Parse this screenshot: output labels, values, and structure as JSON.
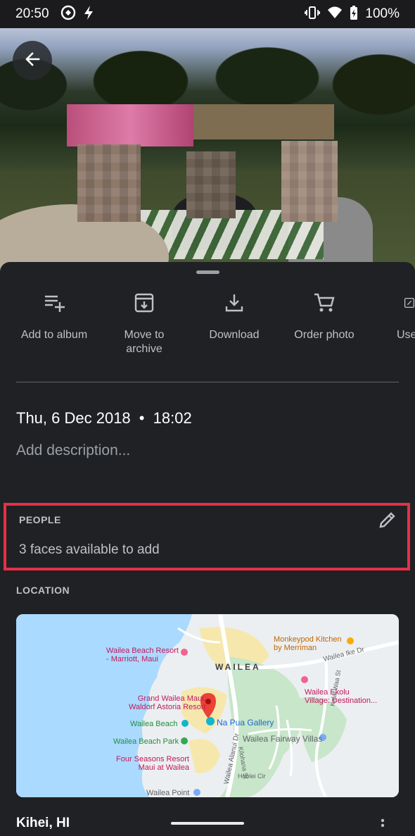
{
  "status_bar": {
    "time": "20:50",
    "battery_percent": "100%",
    "icons": [
      "app-badge-icon",
      "bolt-icon",
      "vibrate-icon",
      "wifi-icon",
      "battery-charging-icon"
    ]
  },
  "header": {
    "back_icon": "arrow-back-icon"
  },
  "photo": {
    "description_hidden": true
  },
  "actions": [
    {
      "label": "Add to album",
      "icon": "playlist-add-icon"
    },
    {
      "label": "Move to archive",
      "icon": "archive-icon"
    },
    {
      "label": "Download",
      "icon": "download-icon"
    },
    {
      "label": "Order photo",
      "icon": "cart-icon"
    },
    {
      "label": "Use",
      "icon": "open-external-icon"
    }
  ],
  "details": {
    "date": "Thu, 6 Dec 2018",
    "separator": "•",
    "time": "18:02",
    "description_placeholder": "Add description..."
  },
  "people": {
    "title": "PEOPLE",
    "summary": "3 faces available to add",
    "edit_icon": "pencil-icon",
    "highlight_color": "#e53048"
  },
  "location": {
    "title": "LOCATION",
    "place_name": "Kihei, HI",
    "map": {
      "labels": {
        "area": "WAILEA",
        "beach_resort": "Wailea Beach Resort\n- Marriott, Maui",
        "grand_wailea": "Grand Wailea Maui,\nWaldorf Astoria Resort",
        "wailea_beach": "Wailea Beach",
        "beach_park": "Wailea Beach Park",
        "four_seasons": "Four Seasons Resort\nMaui at Wailea",
        "na_pua": "Na Pua Gallery",
        "ekolu": "Wailea Ekolu\nVillage: Destination...",
        "fairway": "Wailea Fairway Villas",
        "monkeypod": "Monkeypod Kitchen\nby Merriman",
        "ike_dr": "Wailea Ike Dr",
        "wailea_point": "Wailea Point",
        "alanui": "Wailea Alanui Dr",
        "kilohana": "Kilohana St",
        "hoolei": "Hoolei Cir",
        "kalai_waa": "Kalai Waa St"
      }
    }
  },
  "colors": {
    "background": "#202124",
    "text_primary": "#ffffff",
    "text_secondary": "#bdc1c6",
    "map_water": "#aadaff",
    "map_pin": "#ea4335"
  }
}
